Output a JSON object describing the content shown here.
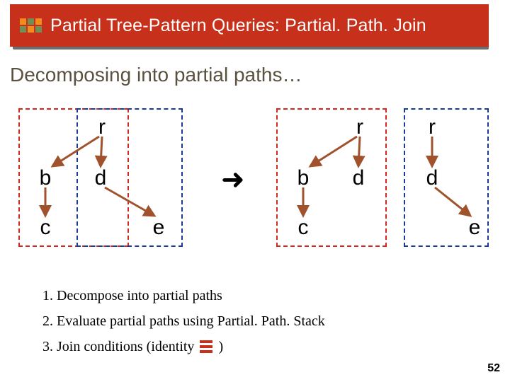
{
  "title": "Partial Tree-Pattern Queries: Partial. Path. Join",
  "heading": "Decomposing into partial paths…",
  "arrow_symbol": "➜",
  "left_tree": {
    "r": "r",
    "b": "b",
    "d": "d",
    "c": "c",
    "e": "e"
  },
  "mid_tree": {
    "r": "r",
    "b": "b",
    "d": "d",
    "c": "c"
  },
  "right_tree": {
    "r": "r",
    "d": "d",
    "e": "e"
  },
  "steps": {
    "s1": "1. Decompose into partial paths",
    "s2": "2. Evaluate partial paths using Partial. Path. Stack",
    "s3_a": "3. Join conditions (identity",
    "s3_b": ")"
  },
  "page_number": "52"
}
